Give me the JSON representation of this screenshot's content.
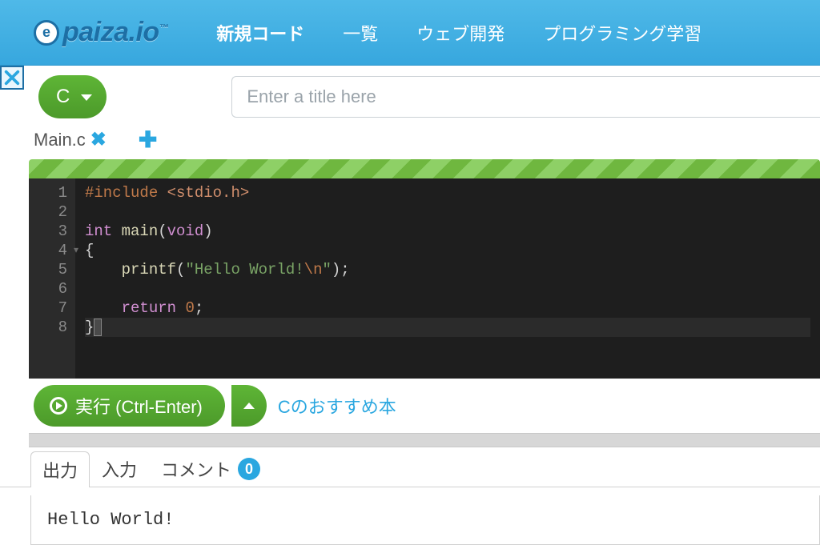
{
  "header": {
    "logo_text": "paiza.io",
    "logo_tm": "™",
    "nav": [
      {
        "label": "新規コード",
        "active": true
      },
      {
        "label": "一覧",
        "active": false
      },
      {
        "label": "ウェブ開発",
        "active": false
      },
      {
        "label": "プログラミング学習",
        "active": false
      }
    ]
  },
  "language": {
    "selected": "C"
  },
  "title": {
    "value": "",
    "placeholder": "Enter a title here"
  },
  "files": {
    "current": "Main.c"
  },
  "editor": {
    "lines": [
      {
        "n": 1,
        "tokens": [
          [
            "pre",
            "#include "
          ],
          [
            "inc",
            "<stdio.h>"
          ]
        ]
      },
      {
        "n": 2,
        "tokens": []
      },
      {
        "n": 3,
        "tokens": [
          [
            "kw",
            "int "
          ],
          [
            "fn",
            "main"
          ],
          [
            "pun",
            "("
          ],
          [
            "type",
            "void"
          ],
          [
            "pun",
            ")"
          ]
        ]
      },
      {
        "n": 4,
        "tokens": [
          [
            "pun",
            "{"
          ]
        ],
        "fold": true
      },
      {
        "n": 5,
        "tokens": [
          [
            "pun",
            "    "
          ],
          [
            "fn",
            "printf"
          ],
          [
            "pun",
            "("
          ],
          [
            "str",
            "\"Hello World!"
          ],
          [
            "esc",
            "\\n"
          ],
          [
            "str",
            "\""
          ],
          [
            "pun",
            ");"
          ]
        ]
      },
      {
        "n": 6,
        "tokens": []
      },
      {
        "n": 7,
        "tokens": [
          [
            "pun",
            "    "
          ],
          [
            "kw",
            "return "
          ],
          [
            "num",
            "0"
          ],
          [
            "pun",
            ";"
          ]
        ]
      },
      {
        "n": 8,
        "tokens": [
          [
            "pun",
            "}"
          ]
        ],
        "current": true
      }
    ]
  },
  "run": {
    "label": "実行 (Ctrl-Enter)",
    "recommend_link": "Cのおすすめ本"
  },
  "bottom_tabs": {
    "output": "出力",
    "input": "入力",
    "comment": "コメント",
    "comment_count": "0"
  },
  "output_text": "Hello World!"
}
